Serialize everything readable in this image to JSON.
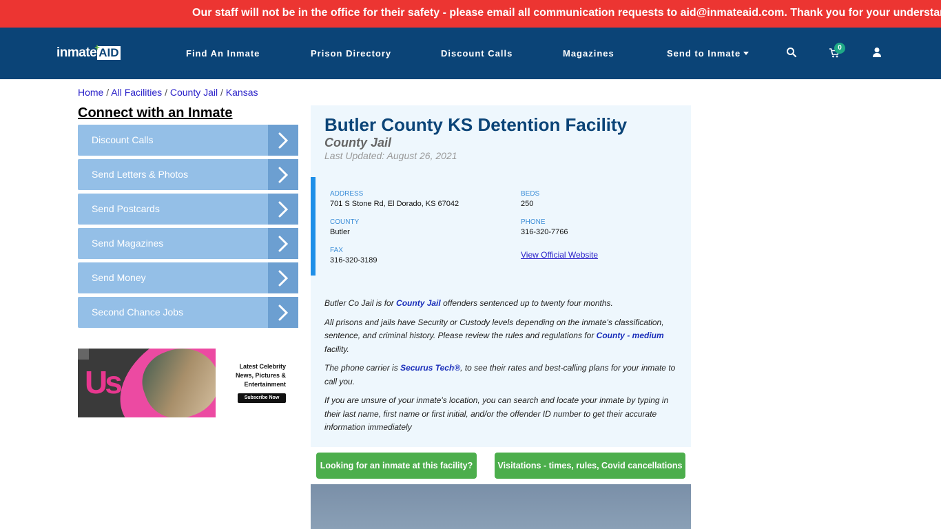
{
  "alert": {
    "text": "Our staff will not be in the office for their safety - please email all communication requests to aid@inmateaid.com. Thank you for your understanding."
  },
  "nav": {
    "logo": {
      "part1": "inmate",
      "part2": "AID",
      "plus": "+"
    },
    "links": [
      {
        "label": "Find An Inmate"
      },
      {
        "label": "Prison Directory"
      },
      {
        "label": "Discount Calls"
      },
      {
        "label": "Magazines"
      },
      {
        "label": "Send to Inmate",
        "dropdown": true
      }
    ],
    "icons": [
      "search-icon",
      "cart-icon",
      "user-icon"
    ],
    "cart_count": "0"
  },
  "breadcrumb": {
    "items": [
      "Home",
      "All Facilities",
      "County Jail",
      "Kansas"
    ],
    "separator": "/"
  },
  "sidebar": {
    "title": "Connect with an Inmate",
    "items": [
      {
        "label": "Discount Calls"
      },
      {
        "label": "Send Letters & Photos"
      },
      {
        "label": "Send Postcards"
      },
      {
        "label": "Send Magazines"
      },
      {
        "label": "Send Money"
      },
      {
        "label": "Second Chance Jobs"
      }
    ],
    "ad": {
      "brand": "Us",
      "headline_lines": [
        "Latest Celebrity",
        "News, Pictures &",
        "Entertainment"
      ],
      "cta": "Subscribe Now"
    }
  },
  "facility": {
    "name": "Butler County KS Detention Facility",
    "type": "County Jail",
    "updated": "Last Updated: August 26, 2021",
    "info": {
      "address_label": "ADDRESS",
      "address": "701 S Stone Rd, El Dorado, KS 67042",
      "beds_label": "BEDS",
      "beds": "250",
      "county_label": "COUNTY",
      "county": "Butler",
      "phone_label": "PHONE",
      "phone": "316-320-7766",
      "fax_label": "FAX",
      "fax": "316-320-3189",
      "website_link": "View Official Website"
    },
    "description": {
      "p1_pre": "Butler Co Jail is for ",
      "p1_link": "County Jail",
      "p1_post": " offenders sentenced up to twenty four months.",
      "p2_pre": "All prisons and jails have Security or Custody levels depending on the inmate's classification, sentence, and criminal history. Please review the rules and regulations for ",
      "p2_link": "County - medium",
      "p2_post": " facility.",
      "p3_pre": "The phone carrier is ",
      "p3_link": "Securus Tech®",
      "p3_post": ", to see their rates and best-calling plans for your inmate to call you.",
      "p4": "If you are unsure of your inmate's location, you can search and locate your inmate by typing in their last name, first name or first initial, and/or the offender ID number to get their accurate information immediately"
    }
  },
  "actions": {
    "find_inmate": "Looking for an inmate at this facility?",
    "visitations": "Visitations - times, rules, Covid cancellations"
  },
  "colors": {
    "alert_bg": "#ec3532",
    "nav_bg": "#0b4477",
    "sidebar_item": "#94bfe7",
    "sidebar_arrow": "#6c9fd1",
    "card_bg": "#eef7fd",
    "accent_blue": "#1e8fe8",
    "button_green": "#4cae4c",
    "badge_teal": "#1fa886"
  }
}
